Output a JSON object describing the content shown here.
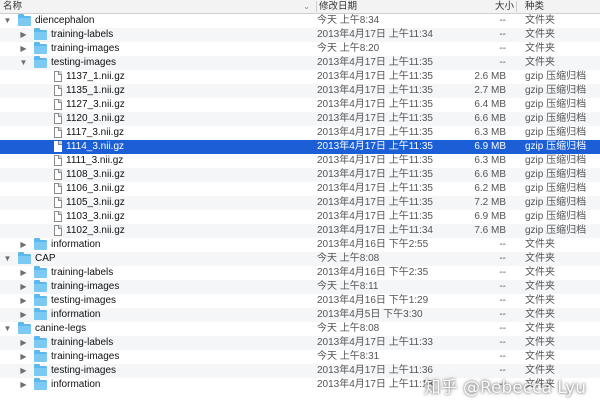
{
  "columns": {
    "name": "名称",
    "date": "修改日期",
    "size": "大小",
    "kind": "种类"
  },
  "rows": [
    {
      "name": "diencephalon",
      "date": "今天 上午8:34",
      "size": "--",
      "kind": "文件夹",
      "level": 0,
      "type": "folder",
      "expanded": true
    },
    {
      "name": "training-labels",
      "date": "2013年4月17日 上午11:34",
      "size": "--",
      "kind": "文件夹",
      "level": 1,
      "type": "folder",
      "expanded": false
    },
    {
      "name": "training-images",
      "date": "今天 上午8:20",
      "size": "--",
      "kind": "文件夹",
      "level": 1,
      "type": "folder",
      "expanded": false
    },
    {
      "name": "testing-images",
      "date": "2013年4月17日 上午11:35",
      "size": "--",
      "kind": "文件夹",
      "level": 1,
      "type": "folder",
      "expanded": true
    },
    {
      "name": "1137_1.nii.gz",
      "date": "2013年4月17日 上午11:35",
      "size": "2.6 MB",
      "kind": "gzip 压缩归档",
      "level": 2,
      "type": "file"
    },
    {
      "name": "1135_1.nii.gz",
      "date": "2013年4月17日 上午11:35",
      "size": "2.7 MB",
      "kind": "gzip 压缩归档",
      "level": 2,
      "type": "file"
    },
    {
      "name": "1127_3.nii.gz",
      "date": "2013年4月17日 上午11:35",
      "size": "6.4 MB",
      "kind": "gzip 压缩归档",
      "level": 2,
      "type": "file"
    },
    {
      "name": "1120_3.nii.gz",
      "date": "2013年4月17日 上午11:35",
      "size": "6.6 MB",
      "kind": "gzip 压缩归档",
      "level": 2,
      "type": "file"
    },
    {
      "name": "1117_3.nii.gz",
      "date": "2013年4月17日 上午11:35",
      "size": "6.3 MB",
      "kind": "gzip 压缩归档",
      "level": 2,
      "type": "file"
    },
    {
      "name": "1114_3.nii.gz",
      "date": "2013年4月17日 上午11:35",
      "size": "6.9 MB",
      "kind": "gzip 压缩归档",
      "level": 2,
      "type": "file",
      "selected": true
    },
    {
      "name": "1111_3.nii.gz",
      "date": "2013年4月17日 上午11:35",
      "size": "6.3 MB",
      "kind": "gzip 压缩归档",
      "level": 2,
      "type": "file"
    },
    {
      "name": "1108_3.nii.gz",
      "date": "2013年4月17日 上午11:35",
      "size": "6.6 MB",
      "kind": "gzip 压缩归档",
      "level": 2,
      "type": "file"
    },
    {
      "name": "1106_3.nii.gz",
      "date": "2013年4月17日 上午11:35",
      "size": "6.2 MB",
      "kind": "gzip 压缩归档",
      "level": 2,
      "type": "file"
    },
    {
      "name": "1105_3.nii.gz",
      "date": "2013年4月17日 上午11:35",
      "size": "7.2 MB",
      "kind": "gzip 压缩归档",
      "level": 2,
      "type": "file"
    },
    {
      "name": "1103_3.nii.gz",
      "date": "2013年4月17日 上午11:35",
      "size": "6.9 MB",
      "kind": "gzip 压缩归档",
      "level": 2,
      "type": "file"
    },
    {
      "name": "1102_3.nii.gz",
      "date": "2013年4月17日 上午11:34",
      "size": "7.6 MB",
      "kind": "gzip 压缩归档",
      "level": 2,
      "type": "file"
    },
    {
      "name": "information",
      "date": "2013年4月16日 下午2:55",
      "size": "--",
      "kind": "文件夹",
      "level": 1,
      "type": "folder",
      "expanded": false
    },
    {
      "name": "CAP",
      "date": "今天 上午8:08",
      "size": "--",
      "kind": "文件夹",
      "level": 0,
      "type": "folder",
      "expanded": true
    },
    {
      "name": "training-labels",
      "date": "2013年4月16日 下午2:35",
      "size": "--",
      "kind": "文件夹",
      "level": 1,
      "type": "folder",
      "expanded": false
    },
    {
      "name": "training-images",
      "date": "今天 上午8:11",
      "size": "--",
      "kind": "文件夹",
      "level": 1,
      "type": "folder",
      "expanded": false
    },
    {
      "name": "testing-images",
      "date": "2013年4月16日 下午1:29",
      "size": "--",
      "kind": "文件夹",
      "level": 1,
      "type": "folder",
      "expanded": false
    },
    {
      "name": "information",
      "date": "2013年4月5日 下午3:30",
      "size": "--",
      "kind": "文件夹",
      "level": 1,
      "type": "folder",
      "expanded": false
    },
    {
      "name": "canine-legs",
      "date": "今天 上午8:08",
      "size": "--",
      "kind": "文件夹",
      "level": 0,
      "type": "folder",
      "expanded": true
    },
    {
      "name": "training-labels",
      "date": "2013年4月17日 上午11:33",
      "size": "--",
      "kind": "文件夹",
      "level": 1,
      "type": "folder",
      "expanded": false
    },
    {
      "name": "training-images",
      "date": "今天 上午8:31",
      "size": "--",
      "kind": "文件夹",
      "level": 1,
      "type": "folder",
      "expanded": false
    },
    {
      "name": "testing-images",
      "date": "2013年4月17日 上午11:36",
      "size": "--",
      "kind": "文件夹",
      "level": 1,
      "type": "folder",
      "expanded": false
    },
    {
      "name": "information",
      "date": "2013年4月17日 上午11:18",
      "size": "--",
      "kind": "文件夹",
      "level": 1,
      "type": "folder",
      "expanded": false
    }
  ],
  "watermark": "知乎 @Rebecca Lyu",
  "colors": {
    "selection": "#1b5ed6",
    "folder": "#5db8ee",
    "stripe": "#f4f6f8"
  },
  "icons": {
    "expanded": "triangle-down-icon",
    "collapsed": "triangle-right-icon",
    "folder": "folder-icon",
    "file": "document-icon"
  }
}
